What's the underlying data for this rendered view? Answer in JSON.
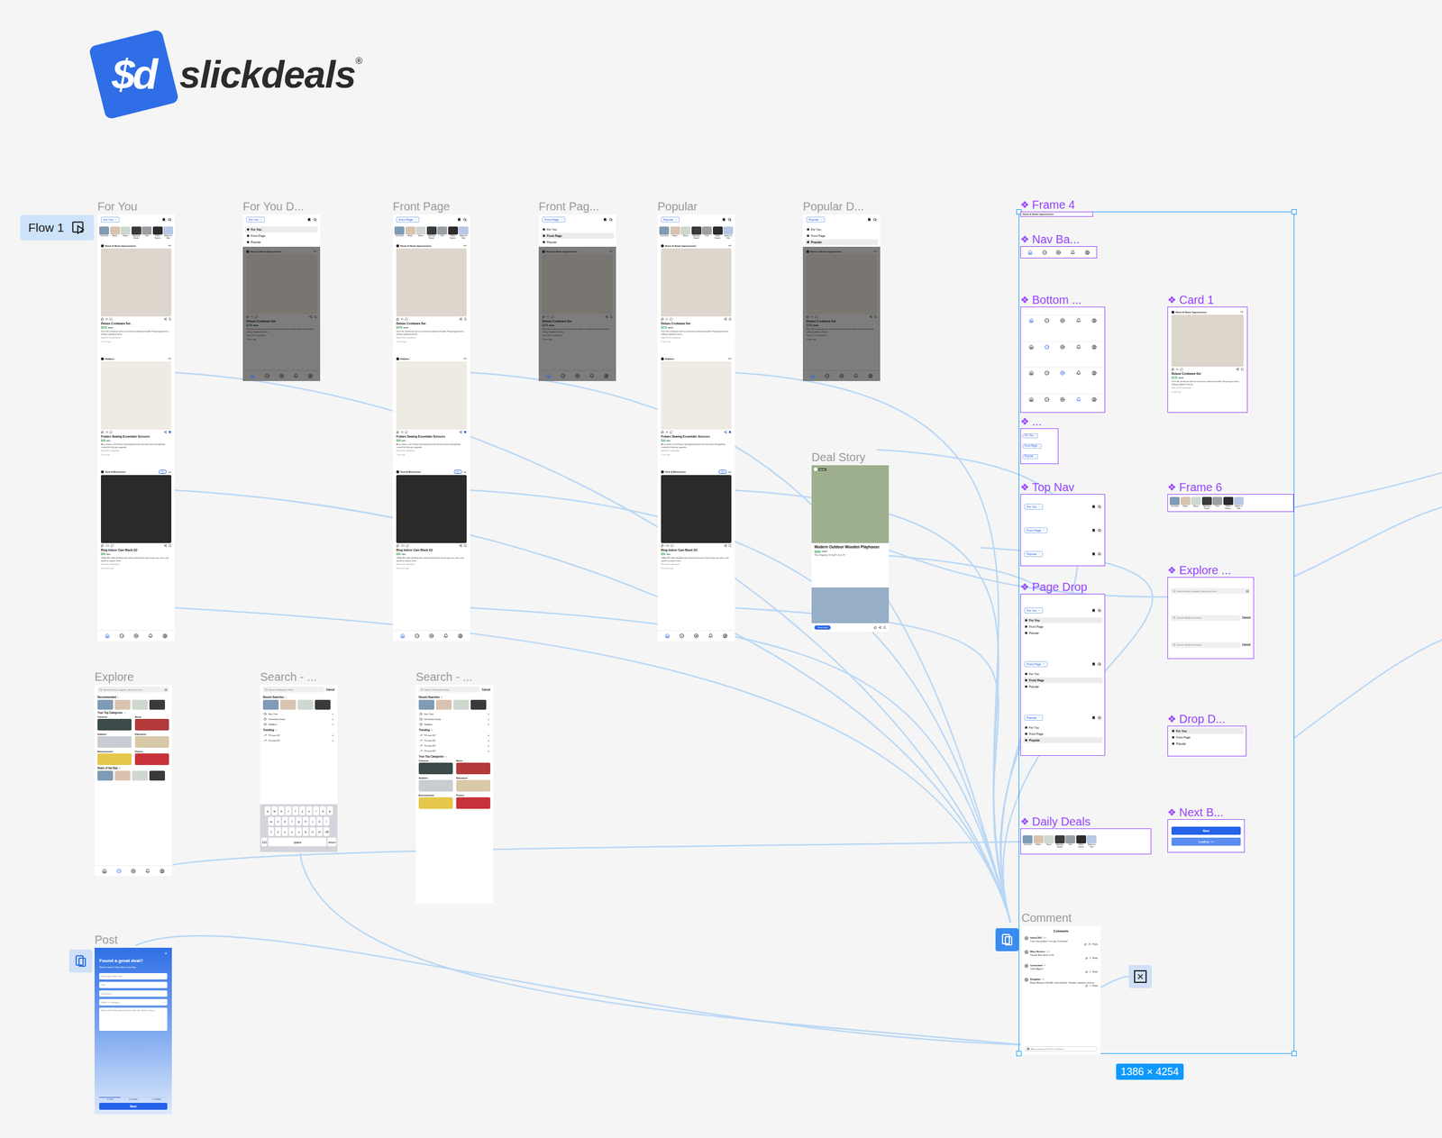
{
  "logo": {
    "mark": "$d",
    "name": "slickdeals",
    "registered": "®"
  },
  "flow": {
    "label": "Flow 1"
  },
  "menu_options": [
    "For You",
    "Front Page",
    "Popular"
  ],
  "bottom_nav": [
    {
      "kind": "home",
      "selected": true
    },
    {
      "kind": "explore",
      "selected": false
    },
    {
      "kind": "post",
      "selected": false
    },
    {
      "kind": "alerts",
      "selected": false
    },
    {
      "kind": "profile",
      "selected": false
    }
  ],
  "daily_deals": [
    {
      "label": "Your Deal",
      "color": "#7f9bb5"
    },
    {
      "label": "Home",
      "color": "#d9c3b0"
    },
    {
      "label": "Shoes",
      "color": "#cfd8cf"
    },
    {
      "label": "Sporting Goods",
      "color": "#3a3a3a"
    },
    {
      "label": "Tech",
      "color": "#9aa0a6"
    },
    {
      "label": "Video Games",
      "color": "#2b2b2b"
    },
    {
      "label": "Babies & Kids",
      "color": "#b9c7e6"
    }
  ],
  "feed_cards": [
    {
      "category": "Home & Home Improvement",
      "likes": "55",
      "title": "Deluxe Cookware Set",
      "price": "$179",
      "was": "$249",
      "description": "Ditch the chemicals with our exclusive cookware bundle. Featuring our best-selling Cookware Set &...",
      "comments": "View all 10 comments",
      "time": "3 hours ago",
      "color": "#dcd6cc",
      "bookmarked": false
    },
    {
      "category": "Hobbies",
      "likes": "23",
      "title": "Fiskars Sewing Essentials Scissors",
      "price": "$18",
      "was": "$25",
      "description": "All six tools in the Fiskars Sewing Essentials Set have been thoughtfully curated to help you upgrade...",
      "comments": "View all 5 comments",
      "time": "1 hour ago",
      "color": "#eeeae4",
      "bookmarked": true
    },
    {
      "category": "Tech & Electronics",
      "likes": "123",
      "title": "Ring Indoor Cam Black G2",
      "price": "$50",
      "was": "$60",
      "description": "1080p HD video doubled with enhanced features that let you see, hear, and speak to anyone from...",
      "comments": "View all 3 comments",
      "time": "30 minutes ago",
      "color": "#2a2a2a",
      "bookmarked": false,
      "join": "Join"
    }
  ],
  "screens": [
    {
      "label": "For You",
      "kind": "feed",
      "menu": "For You"
    },
    {
      "label": "For You D...",
      "kind": "drop",
      "menu": "For You",
      "options": [
        {
          "label": "For You",
          "selected": true
        },
        {
          "label": "Front Page",
          "selected": false
        },
        {
          "label": "Popular",
          "selected": false
        }
      ]
    },
    {
      "label": "Front Page",
      "kind": "feed",
      "menu": "Front Page"
    },
    {
      "label": "Front Pag...",
      "kind": "drop",
      "menu": "Front Page",
      "options": [
        {
          "label": "For You",
          "selected": false
        },
        {
          "label": "Front Page",
          "selected": true
        },
        {
          "label": "Popular",
          "selected": false
        }
      ]
    },
    {
      "label": "Popular",
      "kind": "feed",
      "menu": "Popular"
    },
    {
      "label": "Popular D...",
      "kind": "drop",
      "menu": "Popular",
      "options": [
        {
          "label": "For You",
          "selected": false
        },
        {
          "label": "Front Page",
          "selected": false
        },
        {
          "label": "Popular",
          "selected": true
        }
      ]
    }
  ],
  "deal_story": {
    "label": "Deal Story",
    "user": "deals",
    "title": "Modern Outdoor Wooden Playhouse",
    "price": "$260",
    "was": "$399",
    "shipping": "Free shipping | Get by Fri, Dec 29",
    "button": "View Deal"
  },
  "explore": {
    "label": "Explore",
    "search": "Search deals, coupons, discounts here",
    "sections": [
      "Recommended",
      "Your Top Categories",
      "Deals of the Day"
    ],
    "categories": [
      {
        "label": "Cameras",
        "color": "#3d4a4a"
      },
      {
        "label": "Autos",
        "color": "#b23a3a"
      },
      {
        "label": "Hobbies",
        "color": "#c9ccd2"
      },
      {
        "label": "Education",
        "color": "#d8c9a8"
      },
      {
        "label": "Entertainment",
        "color": "#e5c84a"
      },
      {
        "label": "Fitness",
        "color": "#c8323a"
      }
    ],
    "nav_states": [
      false,
      true,
      false,
      false,
      false
    ]
  },
  "search_screens": [
    {
      "label": "Search - ...",
      "placeholder": "Search 'Bathroom Sinks'",
      "cancel": "Cancel",
      "recent_title": "Recent Searches",
      "recent": [
        "Gas Trim",
        "Christmas Deals",
        "Toddlers"
      ],
      "trending_title": "Trending",
      "trending": [
        "TV over 65\"",
        "TV over 65\""
      ],
      "keyboard": [
        [
          "q",
          "w",
          "e",
          "r",
          "t",
          "y",
          "u",
          "i",
          "o",
          "p"
        ],
        [
          "a",
          "s",
          "d",
          "f",
          "g",
          "h",
          "j",
          "k",
          "l"
        ],
        [
          "⇧",
          "z",
          "x",
          "c",
          "v",
          "b",
          "n",
          "m",
          "⌫"
        ],
        [
          "123",
          "space",
          "return"
        ]
      ]
    },
    {
      "label": "Search - ...",
      "placeholder": "Search 'Bathroom Sinks'",
      "cancel": "Cancel",
      "recent_title": "Recent Searches",
      "recent": [
        "Gas Trim",
        "Christmas Deals",
        "Toddlers"
      ],
      "trending_title": "Trending",
      "trending": [
        "TV over 65\"",
        "TV over 65\"",
        "TV over 65\"",
        "TV over 65\""
      ],
      "categories_title": "Your Top Categories",
      "categories": [
        {
          "label": "Cameras",
          "color": "#3d4a4a"
        },
        {
          "label": "Autos",
          "color": "#b23a3a"
        },
        {
          "label": "Hobbies",
          "color": "#c9ccd2"
        },
        {
          "label": "Education",
          "color": "#d8c9a8"
        },
        {
          "label": "Entertainment",
          "color": "#e5c84a"
        },
        {
          "label": "Fitness",
          "color": "#c8323a"
        }
      ]
    }
  ],
  "post": {
    "label": "Post",
    "close": "×",
    "title": "Found a great deal?",
    "subtitle": "Share it now & help others save big",
    "fields": [
      "Paste deal URL here",
      "Title",
      "Deal price"
    ],
    "category": "Select a Category",
    "description": "Share with fellow deal hunters why this deal is great...",
    "steps": [
      "1. Post",
      "2. Details",
      "3. Submit"
    ],
    "button": "Next"
  },
  "comment": {
    "label": "Comment",
    "title": "Comments",
    "items": [
      {
        "user": "ladiesCEO",
        "time": "11h",
        "text": "Love this product! I've got 3 at home!",
        "likes": "24"
      },
      {
        "user": "Mary Stevens",
        "time": "10h",
        "text": "Saved! Best deal so far",
        "likes": "3"
      },
      {
        "user": "Carmichael",
        "time": "8h",
        "text": "100% Agree!",
        "likes": "2"
      },
      {
        "user": "Dingbabe",
        "time": "2h",
        "text": "Buyer Beware! Handle came broken. Terrible customer service.",
        "likes": "1"
      }
    ],
    "reply": "Reply",
    "input": "Add a comment to Deluxe Cookware..."
  },
  "components": {
    "mark": "❖",
    "frame4": {
      "label": "Frame 4",
      "text": "Home & Home Improvement"
    },
    "nav": "Nav Ba...",
    "bottom": {
      "label": "Bottom ...",
      "variants": [
        [
          true,
          false,
          false,
          false,
          false
        ],
        [
          false,
          true,
          false,
          false,
          false
        ],
        [
          false,
          false,
          true,
          false,
          false
        ],
        [
          false,
          false,
          false,
          true,
          false
        ]
      ]
    },
    "card": "Card 1",
    "pills": "...",
    "top_nav": "Top Nav",
    "frame6": "Frame 6",
    "page_drop": "Page Drop",
    "explore": "Explore ...",
    "drop": "Drop D...",
    "daily": "Daily Deals",
    "next": {
      "label": "Next B...",
      "button": "Next",
      "loading": "Loading",
      "dots": "•••"
    }
  },
  "selection": {
    "size": "1386 × 4254"
  }
}
